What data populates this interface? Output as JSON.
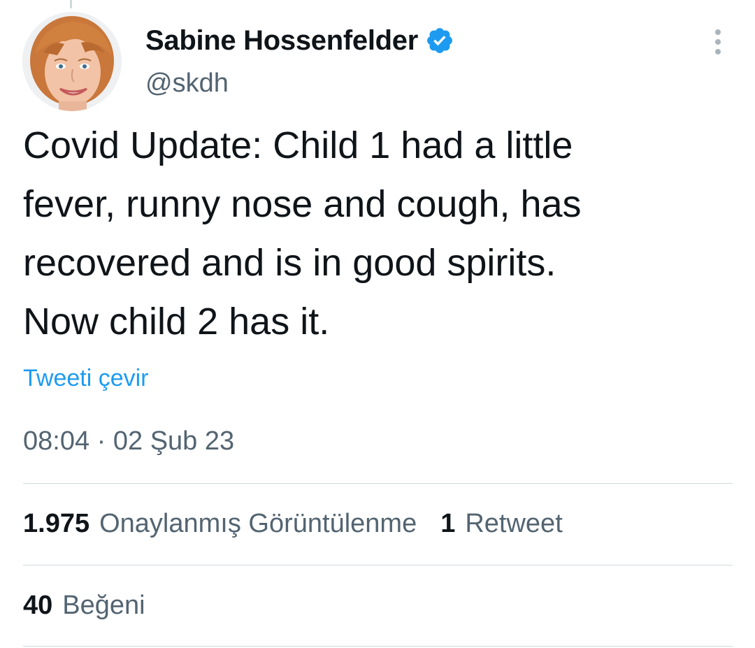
{
  "author": {
    "display_name": "Sabine Hossenfelder",
    "handle": "@skdh",
    "verified": true,
    "avatar_icon": "profile-photo"
  },
  "tweet": {
    "text": "Covid Update: Child 1 had a little\nfever, runny nose and cough, has\nrecovered and is in good spirits.\nNow child 2 has it.",
    "translate_label": "Tweeti çevir",
    "timestamp": "08:04 · 02 Şub 23"
  },
  "stats": {
    "views_count": "1.975",
    "views_label": "Onaylanmış Görüntülenme",
    "retweets_count": "1",
    "retweets_label": "Retweet",
    "likes_count": "40",
    "likes_label": "Beğeni"
  },
  "colors": {
    "accent": "#1d9bf0",
    "text_primary": "#0f1419",
    "text_secondary": "#536471",
    "divider": "#cfd9de"
  },
  "icons": {
    "verified": "verified-badge-icon",
    "more": "more-options-icon"
  }
}
